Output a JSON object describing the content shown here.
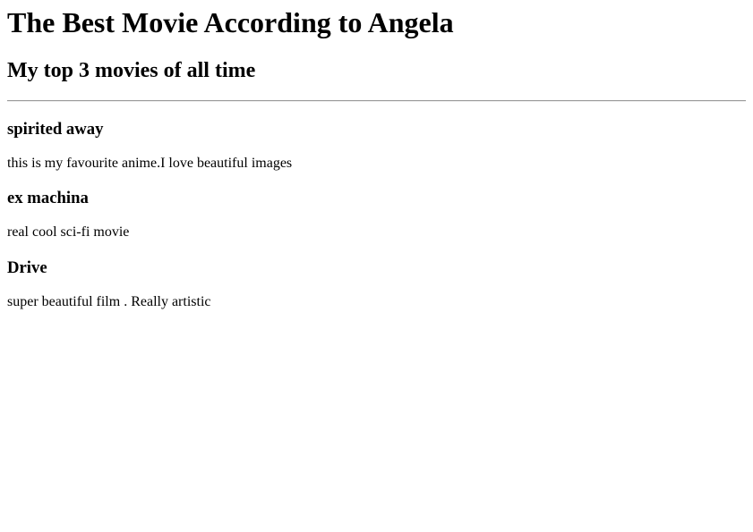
{
  "page": {
    "title": "The Best Movie According to Angela",
    "subtitle": "My top 3 movies of all time"
  },
  "movies": [
    {
      "name": "spirited away",
      "description": "this is my favourite anime.I love beautiful images"
    },
    {
      "name": "ex machina",
      "description": "real cool sci-fi movie"
    },
    {
      "name": "Drive",
      "description": "super beautiful film . Really artistic"
    }
  ]
}
